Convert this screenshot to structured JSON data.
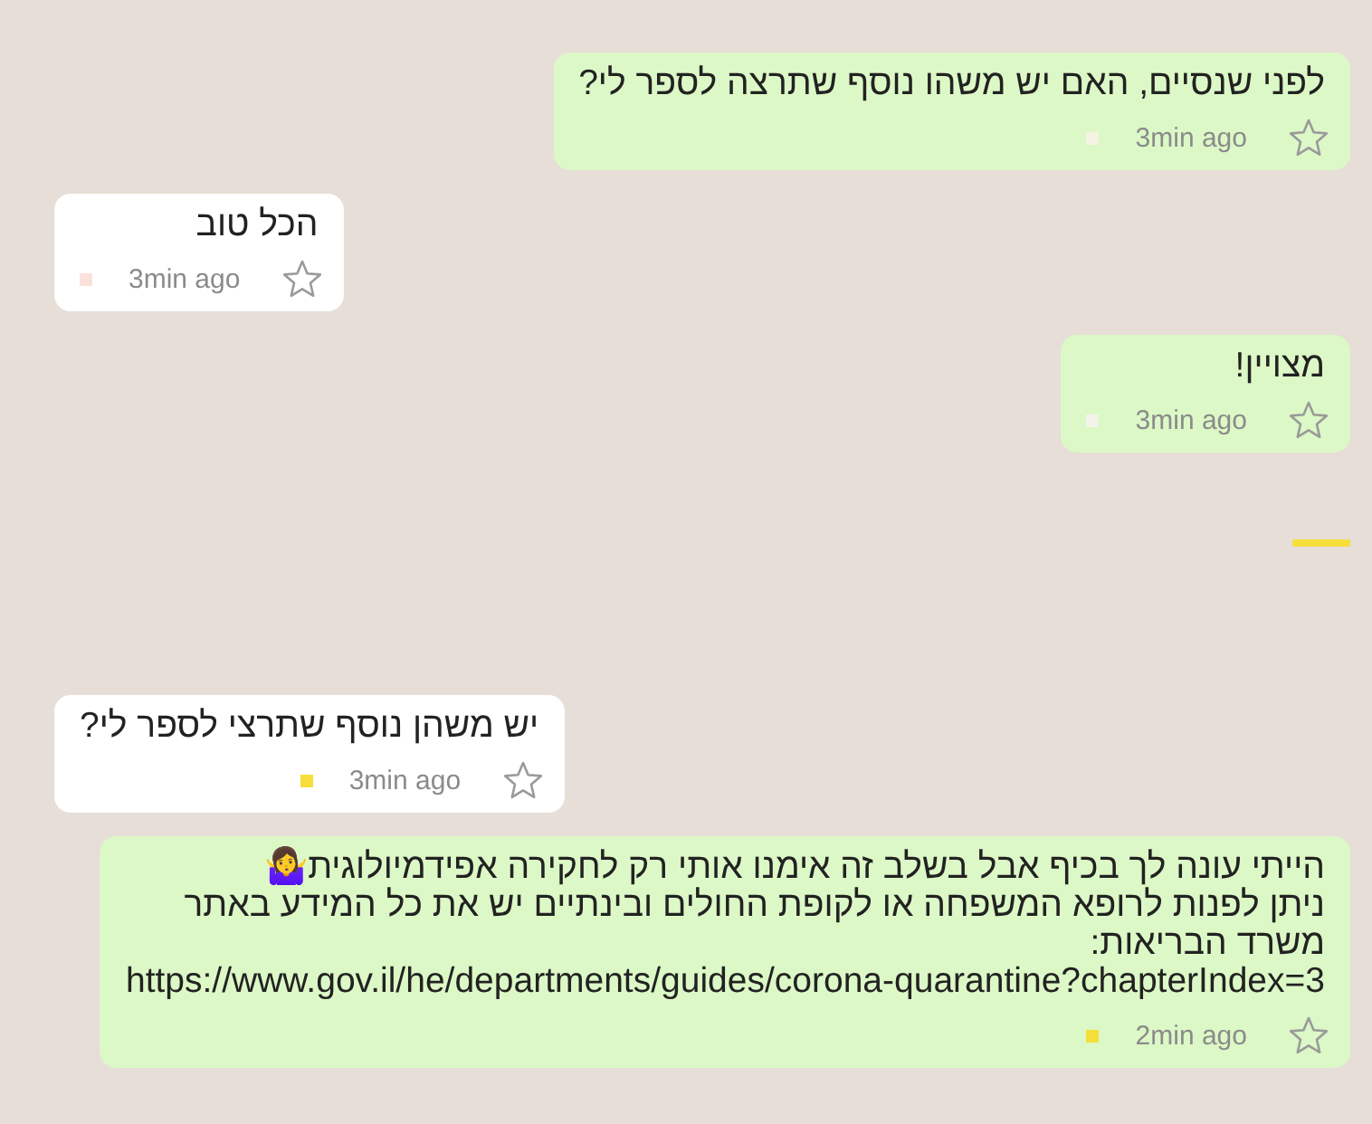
{
  "messages": [
    {
      "kind": "outgoing",
      "text": "לפני שנסיים, האם יש משהו נוסף שתרצה לספר לי?",
      "time": "3min ago",
      "color": "#f7f3e4"
    },
    {
      "kind": "incoming",
      "text": "הכל טוב",
      "time": "3min ago",
      "color": "#fbe1dc"
    },
    {
      "kind": "outgoing",
      "text": "מצויין!",
      "time": "3min ago",
      "color": "#f4f3ea"
    },
    {
      "kind": "incoming",
      "text": "יש משהן נוסף שתרצי לספר לי?",
      "time": "3min ago",
      "color": "#f5de3a"
    },
    {
      "kind": "outgoing",
      "text": "הייתי עונה לך בכיף אבל בשלב זה אימנו אותי רק לחקירה אפידמיולוגית🤷‍♀️\nניתן לפנות לרופא המשפחה או לקופת החולים ובינתיים יש את כל המידע באתר\nמשרד הבריאות:\nhttps://www.gov.il/he/departments/guides/corona-quarantine?chapterIndex=3",
      "time": "2min ago",
      "color": "#f5de3a"
    }
  ]
}
